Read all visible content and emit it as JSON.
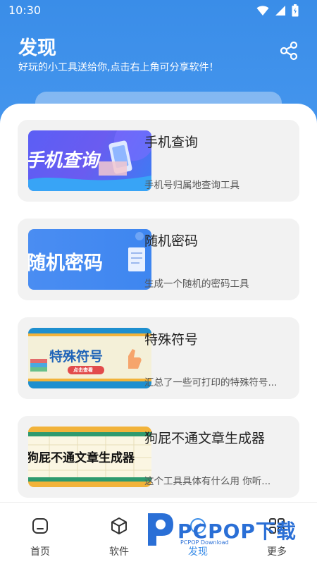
{
  "status_bar": {
    "time": "10:30"
  },
  "header": {
    "title": "发现",
    "subtitle": "好玩的小工具送给你,点击右上角可分享软件！"
  },
  "cards": [
    {
      "title": "手机查询",
      "desc": "手机号归属地查询工具",
      "thumb_text": "手机查询"
    },
    {
      "title": "随机密码",
      "desc": "生成一个随机的密码工具",
      "thumb_text": "随机密码"
    },
    {
      "title": "特殊符号",
      "desc": "汇总了一些可打印的特殊符号...",
      "thumb_text": "特殊符号",
      "thumb_sub": "点击查看"
    },
    {
      "title": "狗屁不通文章生成器",
      "desc": "这个工具具体有什么用 你听...",
      "thumb_text": "狗屁不通文章生成器"
    }
  ],
  "nav": [
    {
      "label": "首页",
      "icon": "home-icon"
    },
    {
      "label": "软件",
      "icon": "cube-icon"
    },
    {
      "label": "发现",
      "icon": "compass-icon",
      "active": true
    },
    {
      "label": "更多",
      "icon": "more-icon"
    }
  ],
  "watermark": {
    "text": "PCPOP下载",
    "sub": "PCPOP Download"
  },
  "colors": {
    "primary": "#3a8de8",
    "card_bg": "#f2f2f2"
  }
}
